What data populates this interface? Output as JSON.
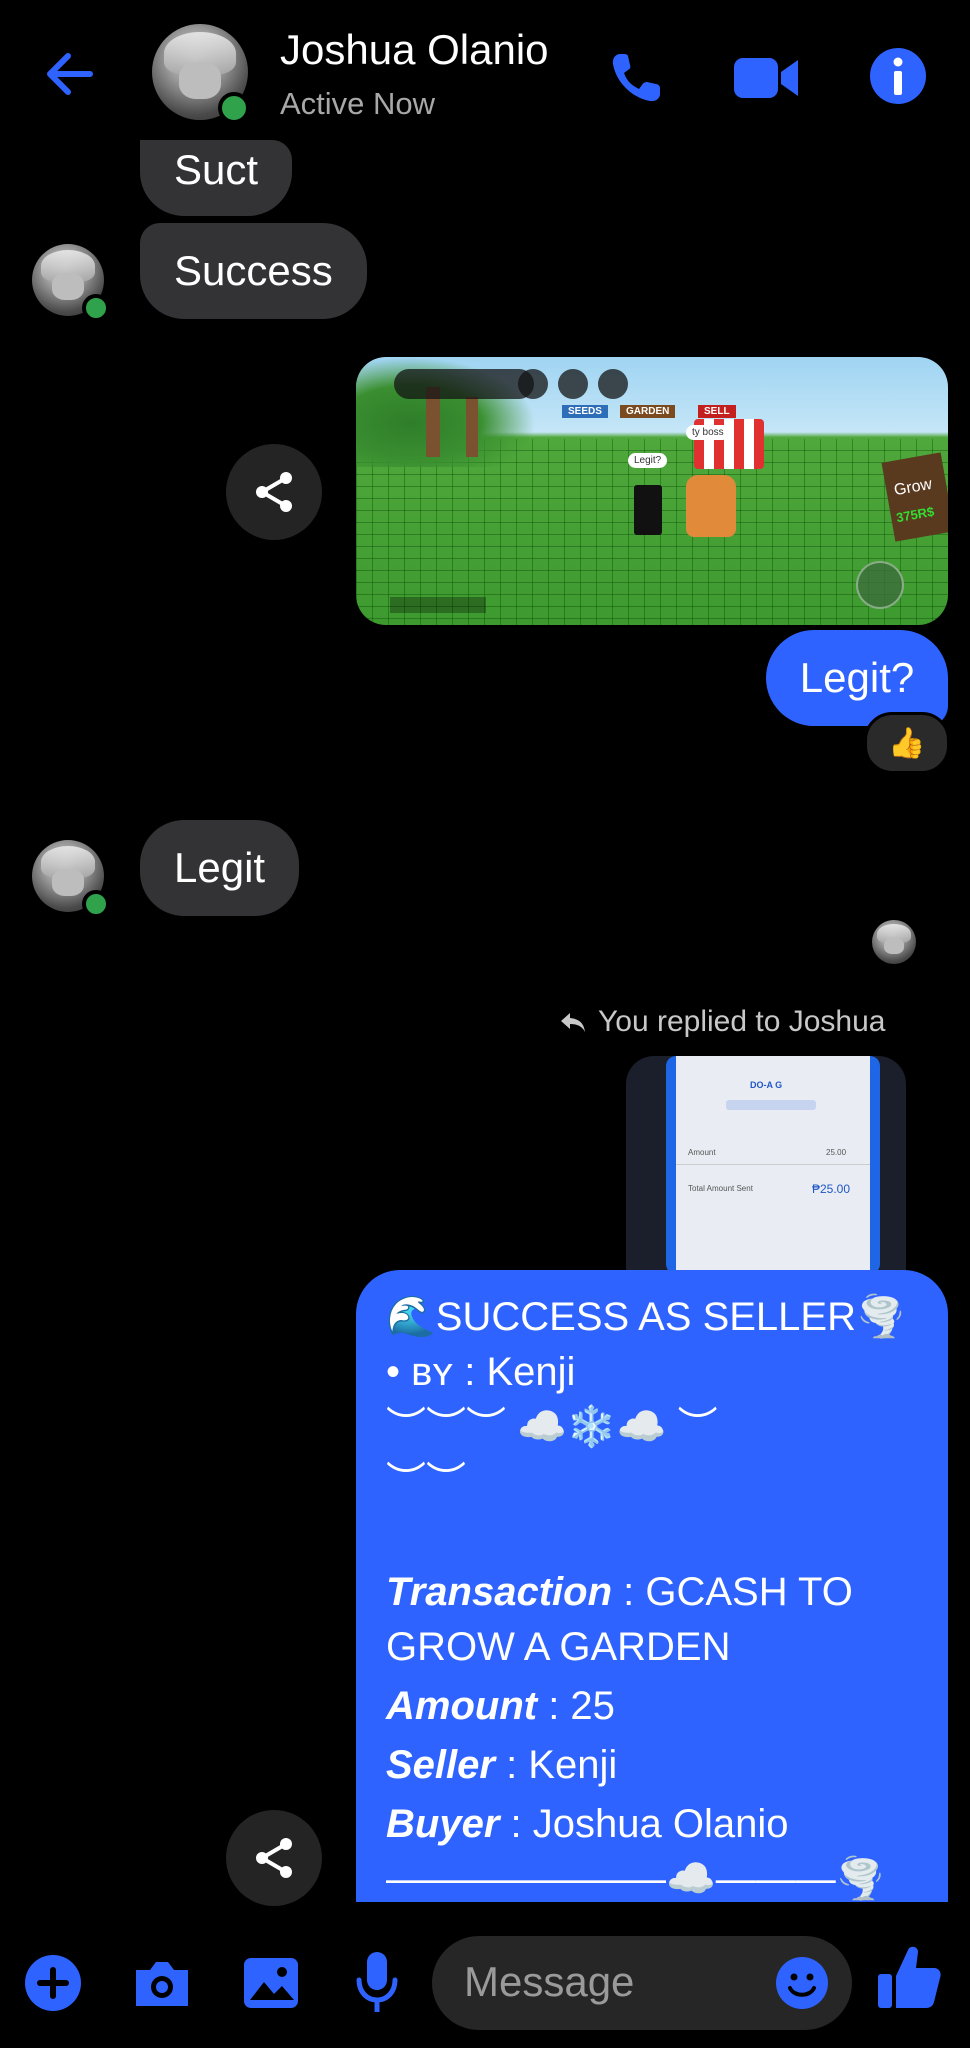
{
  "header": {
    "name": "Joshua Olanio",
    "status": "Active Now"
  },
  "colors": {
    "accent": "#2f63ff",
    "incoming_bubble": "#333336",
    "online": "#31a24c",
    "background": "#000000"
  },
  "icons": [
    "back-arrow-icon",
    "phone-icon",
    "video-icon",
    "info-icon",
    "share-icon",
    "reply-icon",
    "plus-icon",
    "camera-icon",
    "gallery-icon",
    "mic-icon",
    "emoji-icon",
    "thumbs-up-icon"
  ],
  "messages": {
    "in_1": "Suct",
    "in_2": "Success",
    "out_1": "Legit?",
    "out_1_reaction": "👍",
    "in_3": "Legit",
    "reply_note": "You replied to Joshua"
  },
  "game_image": {
    "tab_seeds": "SEEDS",
    "tab_garden": "GARDEN",
    "tab_sell": "SELL",
    "bubble_ty": "ty boss",
    "bubble_legit": "Legit?",
    "sign": "Grow",
    "sign_price": "375R$"
  },
  "receipt_thumb": {
    "brand": "DO-A G",
    "amount_label": "Amount",
    "amount_value": "25.00",
    "total_label": "Total Amount Sent",
    "total_value": "₱25.00"
  },
  "seller_card": {
    "title": "🌊SUCCESS AS SELLER🌪️",
    "by_line": "• ʙʏ : Kenji",
    "deco_1": "︶︶︶ ☁️❄️☁️ ︶",
    "deco_2": "︶︶",
    "transaction_label": "Transaction",
    "transaction_value": " : GCASH TO",
    "transaction_value_2": "GROW A GARDEN",
    "amount_label": "Amount",
    "amount_value": " : 25",
    "seller_label": "Seller",
    "seller_value": " : Kenji",
    "buyer_label": "Buyer",
    "buyer_value": " : Joshua Olanio",
    "footer": "———————☁️———🌪️"
  },
  "composer": {
    "placeholder": "Message"
  }
}
